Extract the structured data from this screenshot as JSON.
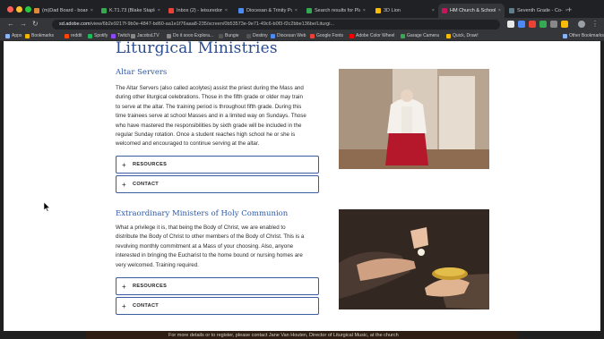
{
  "browser": {
    "tabs": [
      {
        "label": "(m)Dad Board - board",
        "color": "#e1883a"
      },
      {
        "label": "K.T1.73 (Blake Staple)",
        "color": "#34a853"
      },
      {
        "label": "Inbox (2) - leisuredomi",
        "color": "#ea4335"
      },
      {
        "label": "Diocesan & Trinity Pub",
        "color": "#4c8bf5"
      },
      {
        "label": "Search results for Play",
        "color": "#34a853"
      },
      {
        "label": "3D Lion",
        "color": "#fbbc05"
      },
      {
        "label": "HM Church & School",
        "color": "#c2185b"
      },
      {
        "label": "Seventh Grade - Co-un",
        "color": "#607d8b"
      }
    ],
    "active_tab": 6,
    "address": {
      "host": "sd.adobe.com",
      "path": "/view/6b2e9217f-9b0e-4847-bd60-aa1e1f76aaa8-235/screen/0b53573e-9e71-49c6-b0f3-f2c2bbe136be/Liturgi..."
    },
    "bookmarks": [
      {
        "label": "Apps",
        "color": "#8ab4f8"
      },
      {
        "label": "Bookmarks",
        "color": "#f4b400"
      },
      {
        "label": "reddit",
        "color": "#ff4500"
      },
      {
        "label": "Spotify",
        "color": "#1db954"
      },
      {
        "label": "Twitch",
        "color": "#9146ff"
      },
      {
        "label": "JacobsLTV",
        "color": "#888888"
      },
      {
        "label": "Do it sooo Explora...",
        "color": "#888888"
      },
      {
        "label": "Bungie",
        "color": "#555555"
      },
      {
        "label": "Destiny",
        "color": "#555555"
      },
      {
        "label": "Diocesan Web",
        "color": "#4c8bf5"
      },
      {
        "label": "Google Fonts",
        "color": "#ea4335"
      },
      {
        "label": "Adobe Color Wheel",
        "color": "#ff0000"
      },
      {
        "label": "Garage Camera",
        "color": "#34a853"
      },
      {
        "label": "Quick, Draw!",
        "color": "#fbbc05"
      },
      {
        "label": "Other Bookmarks",
        "color": "#8ab4f8"
      }
    ]
  },
  "page": {
    "title": "Liturgical Ministries",
    "sections": [
      {
        "heading": "Altar Servers",
        "paragraph_lines": [
          "The Altar Servers (also called acolytes) assist the priest during the Mass and",
          "during other liturgical celebrations. Those in the fifth grade or older may train",
          "to serve at the altar. The training period is throughout fifth grade. During this",
          "time trainees serve at school Masses and in a limited way on Sundays. Those",
          "who have mastered the responsibilities by sixth grade will be included in the",
          "regular Sunday rotation. Once a student reaches high school he or she is",
          "welcomed and encouraged to continue serving at the altar."
        ],
        "accordions": [
          {
            "label": "RESOURCES"
          },
          {
            "label": "CONTACT"
          }
        ]
      },
      {
        "heading": "Extraordinary Ministers of Holy Communion",
        "paragraph_lines": [
          "What a privilege it is, that being the Body of Christ, we are enabled to",
          "distribute the Body of Christ to other members of the Body of Christ. This is a",
          "revolving monthly commitment at a Mass of your choosing. Also, anyone",
          "interested in bringing the Eucharist to the home bound or nursing homes are",
          "very welcomed. Training required."
        ],
        "accordions": [
          {
            "label": "RESOURCES"
          },
          {
            "label": "CONTACT"
          }
        ]
      }
    ],
    "footer_text": "For more details or to register, please contact Jane Van Houten, Director of Liturgical Music, at the church"
  },
  "colors": {
    "accent": "#2b4d8f",
    "heading": "#2f5aa6",
    "accordion_border": "#3b5c9e"
  }
}
